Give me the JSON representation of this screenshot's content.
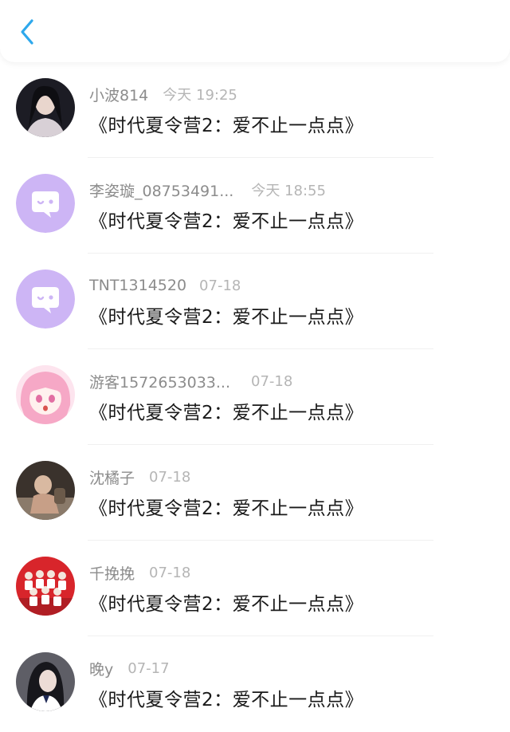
{
  "header": {
    "back_icon": "chevron-left-icon",
    "accent": "#2ea8ec"
  },
  "comments": [
    {
      "name": "小波814",
      "time": "今天 19:25",
      "text": "《时代夏令营2：爱不止一点点》",
      "avatar": "photo-girl"
    },
    {
      "name": "李姿璇_08753491...",
      "time": "今天 18:55",
      "text": "《时代夏令营2：爱不止一点点》",
      "avatar": "chat-bubble-icon"
    },
    {
      "name": "TNT1314520",
      "time": "07-18",
      "text": "《时代夏令营2：爱不止一点点》",
      "avatar": "chat-bubble-icon"
    },
    {
      "name": "游客1572653033...",
      "time": "07-18",
      "text": "《时代夏令营2：爱不止一点点》",
      "avatar": "anime-girl"
    },
    {
      "name": "沈橘子",
      "time": "07-18",
      "text": "《时代夏令营2：爱不止一点点》",
      "avatar": "photo-baby"
    },
    {
      "name": "千挽挽",
      "time": "07-18",
      "text": "《时代夏令营2：爱不止一点点》",
      "avatar": "photo-group"
    },
    {
      "name": "晚y",
      "time": "07-17",
      "text": "《时代夏令营2：爱不止一点点》",
      "avatar": "photo-girl-dark"
    }
  ],
  "colors": {
    "default_avatar": "#cdb5f5",
    "name": "#8c8c8c",
    "time": "#b5b5b5",
    "text": "#1a1a1a"
  }
}
